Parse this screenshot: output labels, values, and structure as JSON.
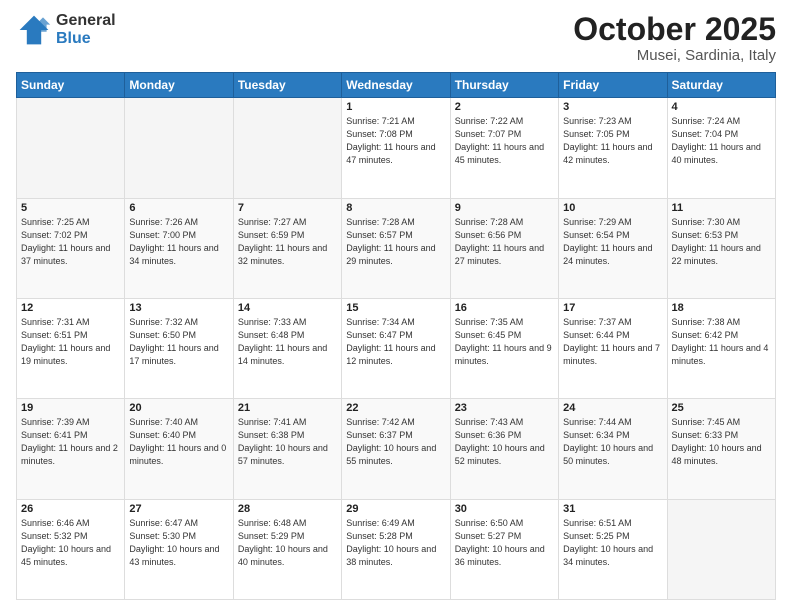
{
  "logo": {
    "general": "General",
    "blue": "Blue"
  },
  "header": {
    "month": "October 2025",
    "location": "Musei, Sardinia, Italy"
  },
  "days_of_week": [
    "Sunday",
    "Monday",
    "Tuesday",
    "Wednesday",
    "Thursday",
    "Friday",
    "Saturday"
  ],
  "weeks": [
    [
      {
        "day": "",
        "sunrise": "",
        "sunset": "",
        "daylight": ""
      },
      {
        "day": "",
        "sunrise": "",
        "sunset": "",
        "daylight": ""
      },
      {
        "day": "",
        "sunrise": "",
        "sunset": "",
        "daylight": ""
      },
      {
        "day": "1",
        "sunrise": "Sunrise: 7:21 AM",
        "sunset": "Sunset: 7:08 PM",
        "daylight": "Daylight: 11 hours and 47 minutes."
      },
      {
        "day": "2",
        "sunrise": "Sunrise: 7:22 AM",
        "sunset": "Sunset: 7:07 PM",
        "daylight": "Daylight: 11 hours and 45 minutes."
      },
      {
        "day": "3",
        "sunrise": "Sunrise: 7:23 AM",
        "sunset": "Sunset: 7:05 PM",
        "daylight": "Daylight: 11 hours and 42 minutes."
      },
      {
        "day": "4",
        "sunrise": "Sunrise: 7:24 AM",
        "sunset": "Sunset: 7:04 PM",
        "daylight": "Daylight: 11 hours and 40 minutes."
      }
    ],
    [
      {
        "day": "5",
        "sunrise": "Sunrise: 7:25 AM",
        "sunset": "Sunset: 7:02 PM",
        "daylight": "Daylight: 11 hours and 37 minutes."
      },
      {
        "day": "6",
        "sunrise": "Sunrise: 7:26 AM",
        "sunset": "Sunset: 7:00 PM",
        "daylight": "Daylight: 11 hours and 34 minutes."
      },
      {
        "day": "7",
        "sunrise": "Sunrise: 7:27 AM",
        "sunset": "Sunset: 6:59 PM",
        "daylight": "Daylight: 11 hours and 32 minutes."
      },
      {
        "day": "8",
        "sunrise": "Sunrise: 7:28 AM",
        "sunset": "Sunset: 6:57 PM",
        "daylight": "Daylight: 11 hours and 29 minutes."
      },
      {
        "day": "9",
        "sunrise": "Sunrise: 7:28 AM",
        "sunset": "Sunset: 6:56 PM",
        "daylight": "Daylight: 11 hours and 27 minutes."
      },
      {
        "day": "10",
        "sunrise": "Sunrise: 7:29 AM",
        "sunset": "Sunset: 6:54 PM",
        "daylight": "Daylight: 11 hours and 24 minutes."
      },
      {
        "day": "11",
        "sunrise": "Sunrise: 7:30 AM",
        "sunset": "Sunset: 6:53 PM",
        "daylight": "Daylight: 11 hours and 22 minutes."
      }
    ],
    [
      {
        "day": "12",
        "sunrise": "Sunrise: 7:31 AM",
        "sunset": "Sunset: 6:51 PM",
        "daylight": "Daylight: 11 hours and 19 minutes."
      },
      {
        "day": "13",
        "sunrise": "Sunrise: 7:32 AM",
        "sunset": "Sunset: 6:50 PM",
        "daylight": "Daylight: 11 hours and 17 minutes."
      },
      {
        "day": "14",
        "sunrise": "Sunrise: 7:33 AM",
        "sunset": "Sunset: 6:48 PM",
        "daylight": "Daylight: 11 hours and 14 minutes."
      },
      {
        "day": "15",
        "sunrise": "Sunrise: 7:34 AM",
        "sunset": "Sunset: 6:47 PM",
        "daylight": "Daylight: 11 hours and 12 minutes."
      },
      {
        "day": "16",
        "sunrise": "Sunrise: 7:35 AM",
        "sunset": "Sunset: 6:45 PM",
        "daylight": "Daylight: 11 hours and 9 minutes."
      },
      {
        "day": "17",
        "sunrise": "Sunrise: 7:37 AM",
        "sunset": "Sunset: 6:44 PM",
        "daylight": "Daylight: 11 hours and 7 minutes."
      },
      {
        "day": "18",
        "sunrise": "Sunrise: 7:38 AM",
        "sunset": "Sunset: 6:42 PM",
        "daylight": "Daylight: 11 hours and 4 minutes."
      }
    ],
    [
      {
        "day": "19",
        "sunrise": "Sunrise: 7:39 AM",
        "sunset": "Sunset: 6:41 PM",
        "daylight": "Daylight: 11 hours and 2 minutes."
      },
      {
        "day": "20",
        "sunrise": "Sunrise: 7:40 AM",
        "sunset": "Sunset: 6:40 PM",
        "daylight": "Daylight: 11 hours and 0 minutes."
      },
      {
        "day": "21",
        "sunrise": "Sunrise: 7:41 AM",
        "sunset": "Sunset: 6:38 PM",
        "daylight": "Daylight: 10 hours and 57 minutes."
      },
      {
        "day": "22",
        "sunrise": "Sunrise: 7:42 AM",
        "sunset": "Sunset: 6:37 PM",
        "daylight": "Daylight: 10 hours and 55 minutes."
      },
      {
        "day": "23",
        "sunrise": "Sunrise: 7:43 AM",
        "sunset": "Sunset: 6:36 PM",
        "daylight": "Daylight: 10 hours and 52 minutes."
      },
      {
        "day": "24",
        "sunrise": "Sunrise: 7:44 AM",
        "sunset": "Sunset: 6:34 PM",
        "daylight": "Daylight: 10 hours and 50 minutes."
      },
      {
        "day": "25",
        "sunrise": "Sunrise: 7:45 AM",
        "sunset": "Sunset: 6:33 PM",
        "daylight": "Daylight: 10 hours and 48 minutes."
      }
    ],
    [
      {
        "day": "26",
        "sunrise": "Sunrise: 6:46 AM",
        "sunset": "Sunset: 5:32 PM",
        "daylight": "Daylight: 10 hours and 45 minutes."
      },
      {
        "day": "27",
        "sunrise": "Sunrise: 6:47 AM",
        "sunset": "Sunset: 5:30 PM",
        "daylight": "Daylight: 10 hours and 43 minutes."
      },
      {
        "day": "28",
        "sunrise": "Sunrise: 6:48 AM",
        "sunset": "Sunset: 5:29 PM",
        "daylight": "Daylight: 10 hours and 40 minutes."
      },
      {
        "day": "29",
        "sunrise": "Sunrise: 6:49 AM",
        "sunset": "Sunset: 5:28 PM",
        "daylight": "Daylight: 10 hours and 38 minutes."
      },
      {
        "day": "30",
        "sunrise": "Sunrise: 6:50 AM",
        "sunset": "Sunset: 5:27 PM",
        "daylight": "Daylight: 10 hours and 36 minutes."
      },
      {
        "day": "31",
        "sunrise": "Sunrise: 6:51 AM",
        "sunset": "Sunset: 5:25 PM",
        "daylight": "Daylight: 10 hours and 34 minutes."
      },
      {
        "day": "",
        "sunrise": "",
        "sunset": "",
        "daylight": ""
      }
    ]
  ]
}
